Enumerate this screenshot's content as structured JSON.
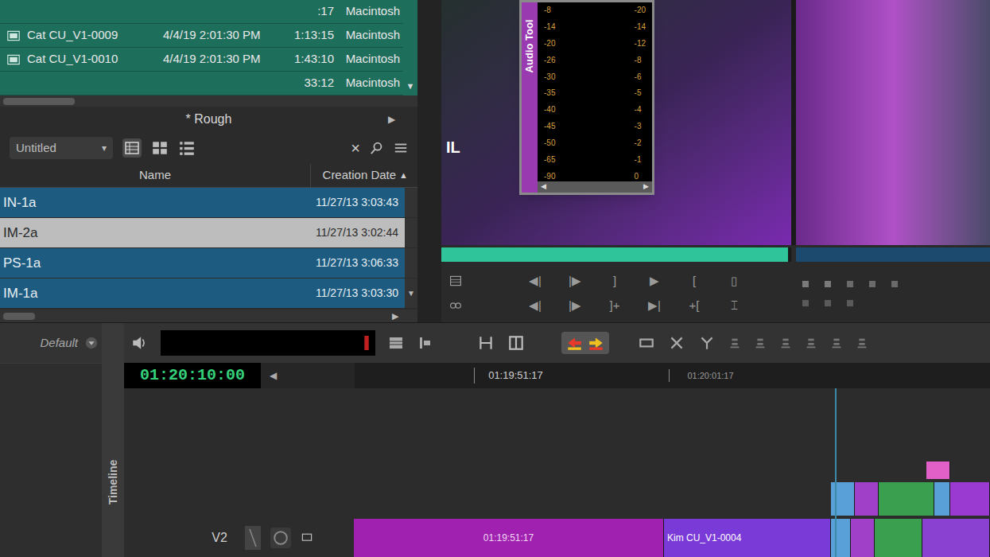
{
  "media_bin": {
    "scroll_down": "▼",
    "rows": [
      {
        "name": "",
        "date": "",
        "duration": ":17",
        "drive": "Macintosh"
      },
      {
        "name": "Cat CU_V1-0009",
        "date": "4/4/19 2:01:30 PM",
        "duration": "1:13:15",
        "drive": "Macintosh"
      },
      {
        "name": "Cat CU_V1-0010",
        "date": "4/4/19 2:01:30 PM",
        "duration": "1:43:10",
        "drive": "Macintosh"
      },
      {
        "name": "",
        "date": "",
        "duration": "33:12",
        "drive": "Macintosh"
      }
    ]
  },
  "rough_bin": {
    "title": "* Rough",
    "arrow": "▶",
    "view": "Untitled",
    "dropdown": "▾",
    "close": "×",
    "columns": [
      {
        "label": "Name"
      },
      {
        "label": "Creation Date",
        "sort": "▲"
      }
    ],
    "rows": [
      {
        "name": "IN-1a",
        "date": "11/27/13 3:03:43",
        "selected": true
      },
      {
        "name": "IM-2a",
        "date": "11/27/13 3:02:44",
        "selected": false
      },
      {
        "name": "PS-1a",
        "date": "11/27/13 3:06:33",
        "selected": true
      },
      {
        "name": "IM-1a",
        "date": "11/27/13 3:03:30",
        "selected": true
      }
    ],
    "scroll_down": "▼",
    "scroll_right": "▶"
  },
  "monitors": {
    "source_overlay": "IL",
    "source_position": 0.99
  },
  "audio_tool": {
    "title": "Audio Tool",
    "left_scale": [
      "-8",
      "-14",
      "-20",
      "-26",
      "-30",
      "-35",
      "-40",
      "-45",
      "-50",
      "-65",
      "-90"
    ],
    "right_scale": [
      "-20",
      "-14",
      "-12",
      "-8",
      "-6",
      "-5",
      "-4",
      "-3",
      "-2",
      "-1",
      "0"
    ],
    "scroll_left": "◀",
    "scroll_right": "▶"
  },
  "transport": {
    "rows": [
      [
        "◀|",
        "|▶",
        "]",
        "▶",
        "[",
        "▯"
      ],
      [
        "◀|",
        "|▶",
        "]+",
        "▶|",
        "+[",
        "⌶"
      ]
    ]
  },
  "timeline": {
    "preset": "Default",
    "tab": "Timeline",
    "timecode": "01:20:10:00",
    "timecode_arrow": "◀",
    "ruler": [
      "01:19:51:17",
      "01:20:01:17"
    ],
    "tracks": [
      {
        "name": "",
        "clips": [
          {
            "label": "",
            "sublabel": "",
            "color": "#e060c8"
          }
        ]
      },
      {
        "name": "",
        "clips": [
          {
            "label": "",
            "sublabel": "",
            "color": "#5aa0d8"
          },
          {
            "label": "",
            "sublabel": "",
            "color": "#a040c8"
          },
          {
            "label": "",
            "sublabel": "",
            "color": "#3aa050"
          },
          {
            "label": "",
            "sublabel": "",
            "color": "#5aa0d8"
          },
          {
            "label": "",
            "sublabel": "",
            "color": "#9a3ad0"
          }
        ]
      },
      {
        "name": "V2",
        "clips": [
          {
            "label": "",
            "sublabel": "01:19:51:17",
            "color": "#a020b0"
          },
          {
            "label": "Kim CU_V1-0004",
            "sublabel": "",
            "color": "#7a3ad8"
          },
          {
            "label": "",
            "sublabel": "",
            "color": "#5aa0d8"
          },
          {
            "label": "",
            "sublabel": "",
            "color": "#a040c8"
          },
          {
            "label": "",
            "sublabel": "",
            "color": "#3aa050"
          },
          {
            "label": "",
            "sublabel": "",
            "color": "#8a40d0"
          }
        ]
      }
    ]
  }
}
